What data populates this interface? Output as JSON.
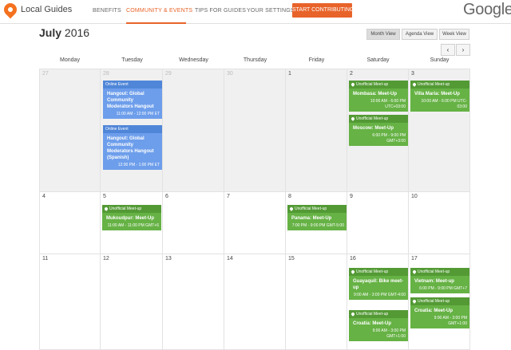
{
  "brand": "Local Guides",
  "nav": [
    "BENEFITS",
    "COMMUNITY & EVENTS",
    "TIPS FOR GUIDES",
    "YOUR SETTINGS"
  ],
  "cta": "START CONTRIBUTING",
  "google_logo": "Google",
  "month": "July",
  "year": "2016",
  "views": [
    "Month View",
    "Agenda View",
    "Week View"
  ],
  "arrows": {
    "prev": "‹",
    "next": "›"
  },
  "weekdays": [
    "Monday",
    "Tuesday",
    "Wednesday",
    "Thursday",
    "Friday",
    "Saturday",
    "Sunday"
  ],
  "weeks": [
    [
      "27",
      "28",
      "29",
      "30",
      "1",
      "2",
      "3"
    ],
    [
      "4",
      "5",
      "6",
      "7",
      "8",
      "9",
      "10"
    ],
    [
      "11",
      "12",
      "13",
      "14",
      "15",
      "16",
      "17"
    ]
  ],
  "events": [
    {
      "kind": "Online Event",
      "title": "Hangout: Global Community Moderators Hangout",
      "time": "11:00 AM - 12:00 PM ET"
    },
    {
      "kind": "Online Event",
      "title": "Hangout: Global Community Moderators Hangout (Spanish)",
      "time": "12:00 PM - 1:00 PM ET"
    },
    {
      "kind": "Unofficial Meet-up",
      "title": "Mombasa: Meet-Up",
      "time": "10:00 AM - 6:00 PM UTC+03:00"
    },
    {
      "kind": "Unofficial Meet-up",
      "title": "Moscow: Meet-Up",
      "time": "6:00 PM - 9:00 PM GMT+3:00"
    },
    {
      "kind": "Unofficial Meet-up",
      "title": "Villa Maria: Meet-Up",
      "time": "10:00 AM - 6:00 PM UTC-03:00"
    },
    {
      "kind": "Unofficial Meet-up",
      "title": "Mukoudpur: Meet-Up",
      "time": "11:00 AM - 11:00 PM GMT+6"
    },
    {
      "kind": "Unofficial Meet-up",
      "title": "Panama: Meet-Up",
      "time": "7:00 PM - 9:00 PM GMT-5:00"
    },
    {
      "kind": "Unofficial Meet-up",
      "title": "Guayaquil: Bike meet-up",
      "time": "9:00 AM - 3:00 PM GMT-4:00"
    },
    {
      "kind": "Unofficial Meet-up",
      "title": "Croatia: Meet-Up",
      "time": "9:00 AM - 3:00 PM GMT+1:00"
    },
    {
      "kind": "Unofficial Meet-up",
      "title": "Vietnam: Meet-up",
      "time": "6:00 PM - 9:00 PM GMT+7"
    },
    {
      "kind": "Unofficial Meet-up",
      "title": "Croatia: Meet-Up",
      "time": "9:00 AM - 3:00 PM GMT+1:00"
    }
  ]
}
